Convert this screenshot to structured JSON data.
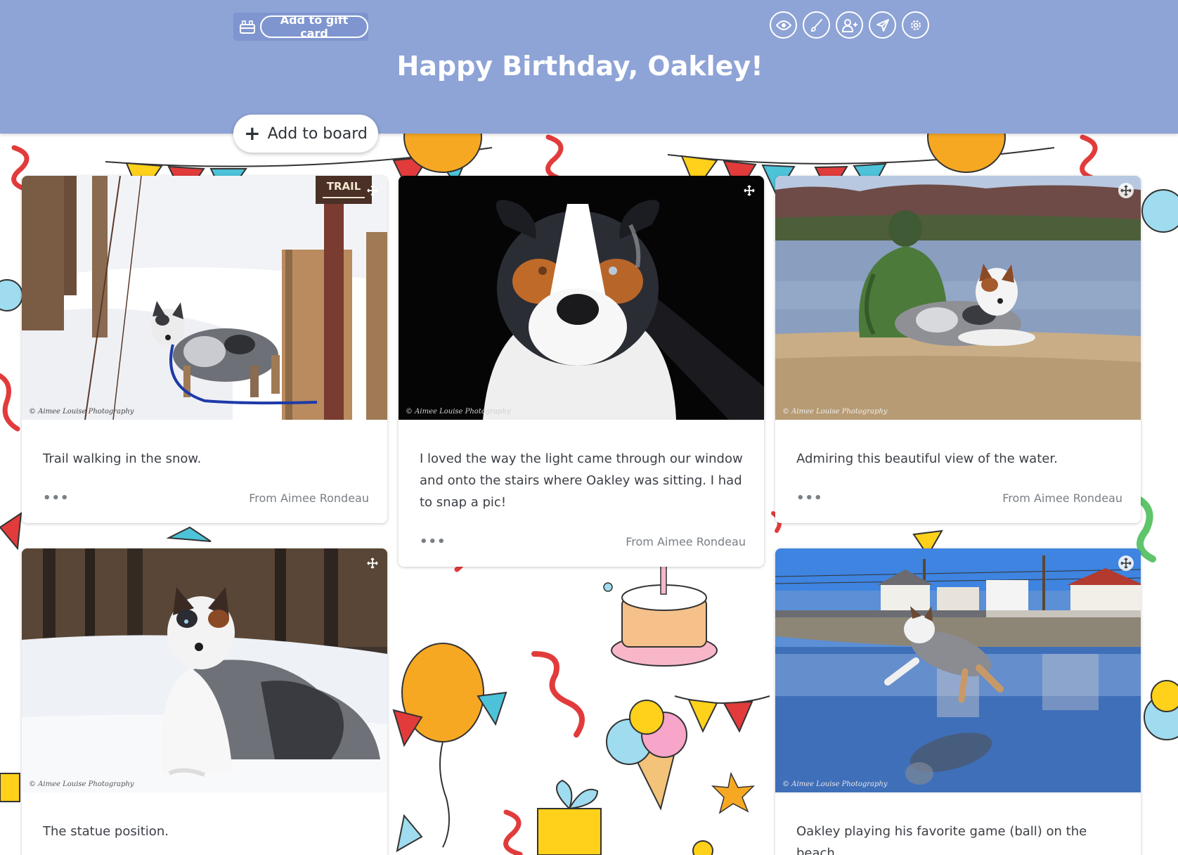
{
  "header": {
    "title": "Happy Birthday, Oakley!",
    "gift_button": "Add to gift card",
    "add_board": "Add to board",
    "tools": [
      "eye-icon",
      "brush-icon",
      "add-user-icon",
      "send-icon",
      "gear-icon"
    ],
    "background_color": "#8ea3d6"
  },
  "cards": [
    {
      "caption": "Trail walking in the snow.",
      "from": "From Aimee Rondeau",
      "more": "•••",
      "watermark": "© Aimee Louise Photography",
      "sign": "TRAIL"
    },
    {
      "caption": "I loved the way the light came through our window and onto the stairs where Oakley was sitting. I had to snap a pic!",
      "from": "From Aimee Rondeau",
      "more": "•••",
      "watermark": "© Aimee Louise Photography"
    },
    {
      "caption": "Admiring this beautiful view of the water.",
      "from": "From Aimee Rondeau",
      "more": "•••",
      "watermark": "© Aimee Louise Photography"
    },
    {
      "caption": "The statue position.",
      "watermark": "© Aimee Louise Photography"
    },
    {
      "caption": "Oakley playing his favorite game (ball) on the beach.",
      "watermark": "© Aimee Louise Photography"
    }
  ]
}
